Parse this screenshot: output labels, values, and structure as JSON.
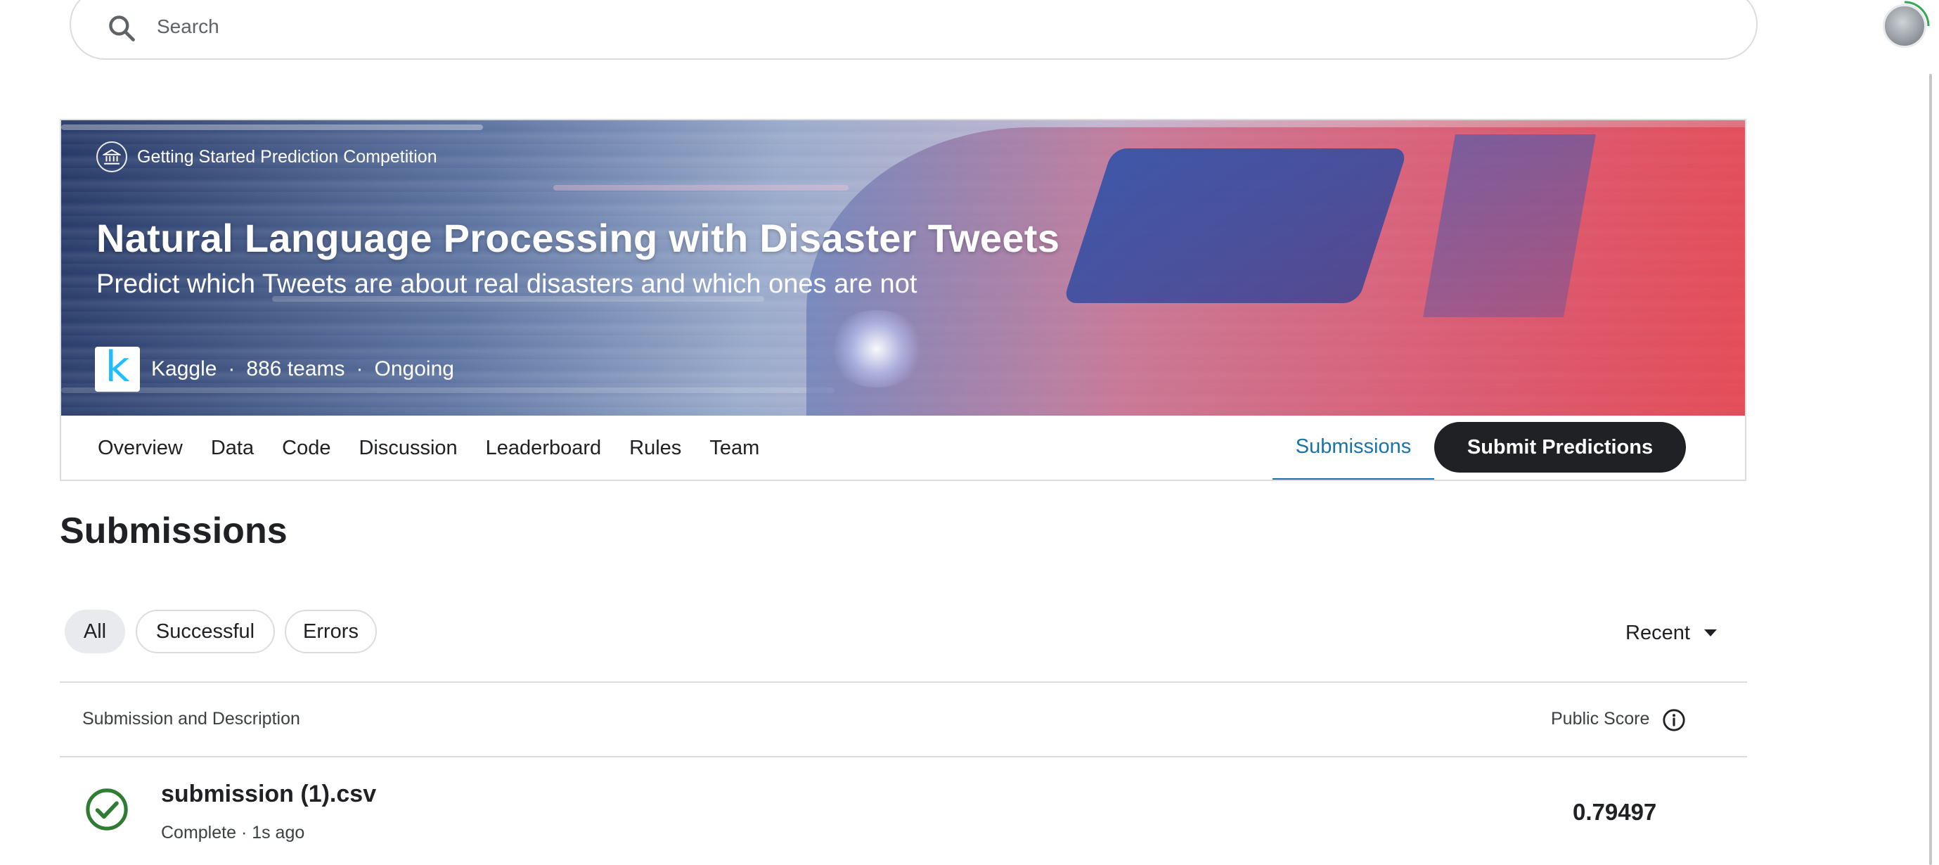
{
  "search": {
    "placeholder": "Search"
  },
  "competition": {
    "type_label": "Getting Started Prediction Competition",
    "title": "Natural Language Processing with Disaster Tweets",
    "subtitle": "Predict which Tweets are about real disasters and which ones are not",
    "host_logo_letter": "k",
    "host": "Kaggle",
    "separator": "·",
    "teams": "886 teams",
    "status": "Ongoing"
  },
  "tabs": [
    {
      "label": "Overview"
    },
    {
      "label": "Data"
    },
    {
      "label": "Code"
    },
    {
      "label": "Discussion"
    },
    {
      "label": "Leaderboard"
    },
    {
      "label": "Rules"
    },
    {
      "label": "Team"
    }
  ],
  "active_tab": {
    "label": "Submissions"
  },
  "submit_button": {
    "label": "Submit Predictions"
  },
  "page": {
    "title": "Submissions"
  },
  "filters": [
    {
      "label": "All",
      "selected": true
    },
    {
      "label": "Successful",
      "selected": false
    },
    {
      "label": "Errors",
      "selected": false
    }
  ],
  "sort": {
    "selected": "Recent"
  },
  "table": {
    "columns": [
      "Submission and Description",
      "Public Score"
    ],
    "rows": [
      {
        "file": "submission (1).csv",
        "status": "Complete · 1s ago",
        "score": "0.79497"
      }
    ]
  },
  "colors": {
    "accent": "#1a73a8",
    "primary_button": "#202124",
    "success": "#34a853",
    "kaggle_blue": "#20beff"
  },
  "icons": [
    "search-icon",
    "bank-icon",
    "more-horiz-icon",
    "caret-down-icon",
    "info-icon",
    "check-circle-icon"
  ]
}
